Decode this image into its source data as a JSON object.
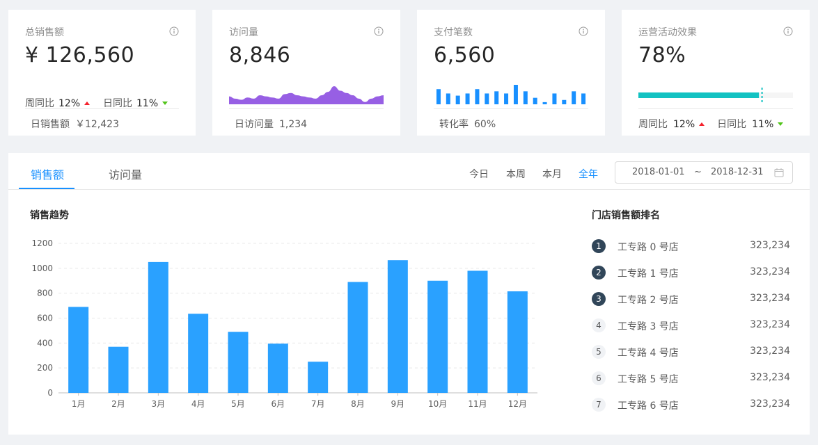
{
  "cards": [
    {
      "title": "总销售额",
      "value": "¥ 126,560",
      "wow_label": "周同比",
      "wow": "12%",
      "dod_label": "日同比",
      "dod": "11%",
      "footer_label": "日销售额",
      "footer_value": "￥12,423"
    },
    {
      "title": "访问量",
      "value": "8,846",
      "footer_label": "日访问量",
      "footer_value": "1,234",
      "area": [
        7,
        5,
        4,
        6,
        5,
        8,
        7,
        6,
        5,
        9,
        10,
        8,
        7,
        6,
        5,
        8,
        11,
        16,
        12,
        10,
        8,
        5,
        2,
        5,
        7,
        8
      ]
    },
    {
      "title": "支付笔数",
      "value": "6,560",
      "footer_label": "转化率",
      "footer_value": "60%",
      "bars": [
        7,
        5,
        4,
        5,
        7,
        5,
        6,
        5,
        9,
        6,
        3,
        1,
        5,
        2,
        6,
        5
      ]
    },
    {
      "title": "运营活动效果",
      "value": "78%",
      "progress": 78,
      "target": 80,
      "wow_label": "周同比",
      "wow": "12%",
      "dod_label": "日同比",
      "dod": "11%"
    }
  ],
  "tabs": [
    "销售额",
    "访问量"
  ],
  "ranges": [
    "今日",
    "本周",
    "本月",
    "全年"
  ],
  "date_start": "2018-01-01",
  "date_sep": "~",
  "date_end": "2018-12-31",
  "trend_title": "销售趋势",
  "rank_title": "门店销售额排名",
  "ranking": [
    {
      "num": "1",
      "name": "工专路 0 号店",
      "value": "323,234"
    },
    {
      "num": "2",
      "name": "工专路 1 号店",
      "value": "323,234"
    },
    {
      "num": "3",
      "name": "工专路 2 号店",
      "value": "323,234"
    },
    {
      "num": "4",
      "name": "工专路 3 号店",
      "value": "323,234"
    },
    {
      "num": "5",
      "name": "工专路 4 号店",
      "value": "323,234"
    },
    {
      "num": "6",
      "name": "工专路 5 号店",
      "value": "323,234"
    },
    {
      "num": "7",
      "name": "工专路 6 号店",
      "value": "323,234"
    }
  ],
  "colors": {
    "accent": "#1890ff",
    "bar": "#2aa1ff",
    "area": "#975fe4",
    "mini_bar": "#1890ff",
    "progress": "#13c2c2"
  },
  "chart_data": {
    "type": "bar",
    "categories": [
      "1月",
      "2月",
      "3月",
      "4月",
      "5月",
      "6月",
      "7月",
      "8月",
      "9月",
      "10月",
      "11月",
      "12月"
    ],
    "values": [
      690,
      370,
      1050,
      635,
      490,
      395,
      250,
      890,
      1065,
      900,
      980,
      815
    ],
    "yticks": [
      0,
      200,
      400,
      600,
      800,
      1000,
      1200
    ],
    "ylim": [
      0,
      1200
    ],
    "title": "",
    "xlabel": "",
    "ylabel": "",
    "grid": true
  }
}
